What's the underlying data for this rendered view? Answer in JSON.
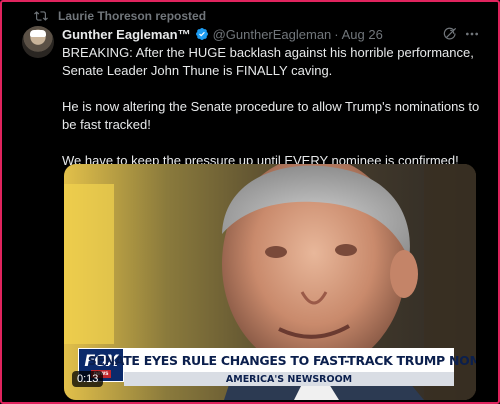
{
  "repost": {
    "label": "Laurie Thoreson reposted"
  },
  "author": {
    "display_name": "Gunther Eagleman™",
    "handle": "@GuntherEagleman",
    "separator": "·",
    "date": "Aug 26"
  },
  "tweet": {
    "paragraphs": [
      "BREAKING: After the HUGE backlash against his horrible performance, Senate Leader John Thune is FINALLY caving.",
      "He is now altering the Senate procedure to allow Trump's nominations to be fast tracked!",
      "We have to keep the pressure up until EVERY nominee is confirmed!"
    ]
  },
  "video": {
    "logo_text": "FOX",
    "logo_sub": "news",
    "headline": "SENATE EYES RULE CHANGES TO FAST-TRACK TRUMP NOMS",
    "show_name": "AMERICA'S NEWSROOM",
    "timestamp": "0:13"
  },
  "colors": {
    "background": "#000000",
    "text": "#e7e9ea",
    "muted": "#71767b",
    "verified": "#1d9bf0",
    "frame_border": "#e0245e",
    "chyron_text": "#0b1f4d"
  },
  "icons": [
    "repost-icon",
    "verified-badge-icon",
    "grok-icon",
    "more-icon"
  ]
}
